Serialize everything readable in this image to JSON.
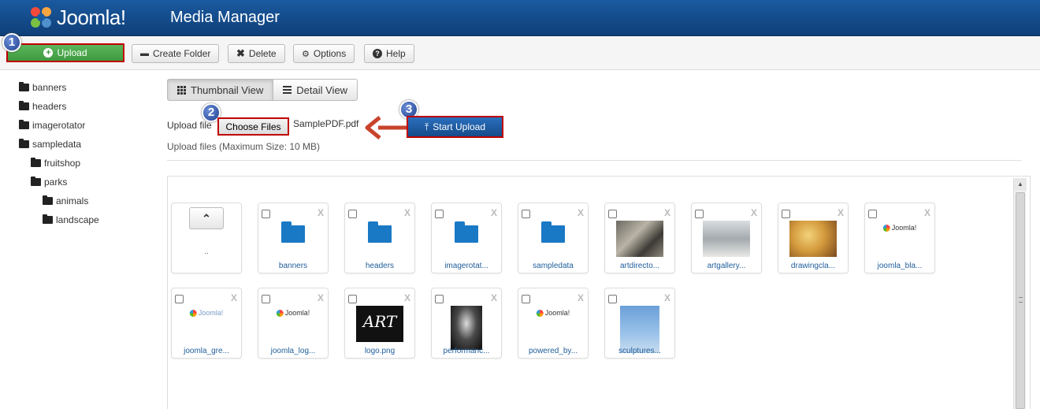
{
  "header": {
    "brand": "Joomla!",
    "title": "Media Manager"
  },
  "toolbar": {
    "upload_label": "Upload",
    "create_folder_label": "Create Folder",
    "delete_label": "Delete",
    "options_label": "Options",
    "help_label": "Help"
  },
  "steps": [
    "1",
    "2",
    "3"
  ],
  "tree": {
    "items": [
      {
        "label": "banners"
      },
      {
        "label": "headers"
      },
      {
        "label": "imagerotator"
      },
      {
        "label": "sampledata"
      },
      {
        "label": "fruitshop"
      },
      {
        "label": "parks"
      },
      {
        "label": "animals"
      },
      {
        "label": "landscape"
      }
    ]
  },
  "views": {
    "thumbnail_label": "Thumbnail View",
    "detail_label": "Detail View"
  },
  "upload_form": {
    "label": "Upload file",
    "choose_label": "Choose Files",
    "file_name": "SamplePDF.pdf",
    "start_label": "Start Upload",
    "max_size": "Upload files (Maximum Size: 10 MB)"
  },
  "media": {
    "up_dots": "..",
    "items": [
      {
        "caption": "banners",
        "kind": "folder"
      },
      {
        "caption": "headers",
        "kind": "folder"
      },
      {
        "caption": "imagerotat...",
        "kind": "folder"
      },
      {
        "caption": "sampledata",
        "kind": "folder"
      },
      {
        "caption": "artdirecto...",
        "kind": "photo"
      },
      {
        "caption": "artgallery...",
        "kind": "photo"
      },
      {
        "caption": "drawingcla...",
        "kind": "photo"
      },
      {
        "caption": "joomla_bla...",
        "kind": "logo"
      },
      {
        "caption": "joomla_gre...",
        "kind": "logo"
      },
      {
        "caption": "joomla_log...",
        "kind": "logo"
      },
      {
        "caption": "logo.png",
        "kind": "art"
      },
      {
        "caption": "performanc...",
        "kind": "photo"
      },
      {
        "caption": "powered_by...",
        "kind": "logo"
      },
      {
        "caption": "sculptures...",
        "kind": "photo"
      }
    ],
    "delete_glyph": "X",
    "logo_text": "Joomla!",
    "art_text": "ART"
  },
  "colors": {
    "header_bg": "#164c8a",
    "upload_green": "#4caf50",
    "highlight_red": "#c00000",
    "folder_blue": "#1a79c5",
    "link_blue": "#1f5d9a"
  }
}
